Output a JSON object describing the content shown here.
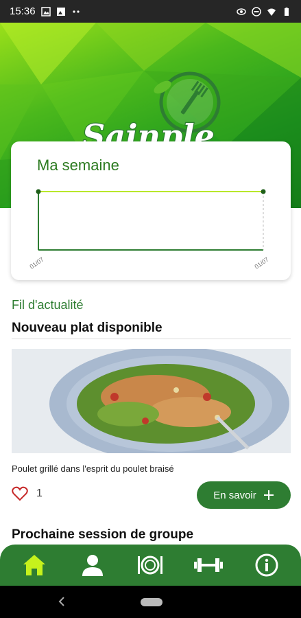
{
  "status_bar": {
    "time": "15:36",
    "icons": [
      "gallery-icon",
      "image-icon",
      "more-dots-icon",
      "eye-icon",
      "dnd-icon",
      "wifi-icon",
      "battery-icon"
    ]
  },
  "app": {
    "logo_text": "Sainple",
    "brand_color": "#2e7d32",
    "accent_color": "#9be01a"
  },
  "week": {
    "title": "Ma semaine",
    "chart_data": {
      "type": "line",
      "x": [
        "01/07",
        "01/07"
      ],
      "series": [
        {
          "values": [
            1,
            1
          ]
        }
      ],
      "title": "Ma semaine",
      "xlabel": "",
      "ylabel": ""
    }
  },
  "feed": {
    "section_title": "Fil d'actualité",
    "card_title": "Nouveau plat disponible",
    "dish_caption": "Poulet grillé dans l'esprit du poulet braisé",
    "likes_count": "1",
    "more_button_label": "En savoir"
  },
  "next_session_title": "Prochaine session de groupe",
  "bottom_nav": [
    {
      "icon": "home-icon",
      "active": true
    },
    {
      "icon": "profile-icon",
      "active": false
    },
    {
      "icon": "plate-icon",
      "active": false
    },
    {
      "icon": "dumbbell-icon",
      "active": false
    },
    {
      "icon": "info-icon",
      "active": false
    }
  ]
}
